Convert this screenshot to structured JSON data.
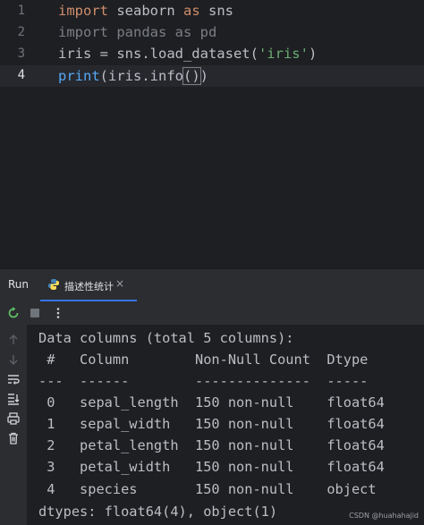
{
  "editor": {
    "line_numbers": [
      "1",
      "2",
      "3",
      "4"
    ],
    "lines": [
      {
        "parts": [
          {
            "text": "import",
            "cls": "kw"
          },
          {
            "text": " seaborn ",
            "cls": ""
          },
          {
            "text": "as",
            "cls": "kw"
          },
          {
            "text": " sns",
            "cls": ""
          }
        ]
      },
      {
        "parts": [
          {
            "text": "import pandas as pd",
            "cls": "dim"
          }
        ]
      },
      {
        "parts": [
          {
            "text": "iris = sns.load_dataset(",
            "cls": ""
          },
          {
            "text": "'iris'",
            "cls": "str"
          },
          {
            "text": ")",
            "cls": ""
          }
        ]
      },
      {
        "parts": [
          {
            "text": "print",
            "cls": "fn"
          },
          {
            "text": "(iris.info",
            "cls": ""
          },
          {
            "text": "()",
            "cls": "paren-box"
          },
          {
            "text": ")",
            "cls": ""
          }
        ]
      }
    ]
  },
  "run_panel": {
    "title": "Run",
    "tab_label": "描述性统计",
    "tab_close": "×"
  },
  "console": {
    "lines": [
      "Data columns (total 5 columns):",
      " #   Column        Non-Null Count  Dtype  ",
      "---  ------        --------------  -----  ",
      " 0   sepal_length  150 non-null    float64",
      " 1   sepal_width   150 non-null    float64",
      " 2   petal_length  150 non-null    float64",
      " 3   petal_width   150 non-null    float64",
      " 4   species       150 non-null    object ",
      "dtypes: float64(4), object(1)"
    ]
  },
  "watermark": "CSDN @huahahajid",
  "icons": {
    "rerun": "rerun-icon",
    "stop": "stop-icon",
    "more": "more-vertical-icon",
    "up": "arrow-up-icon",
    "down": "arrow-down-icon",
    "wrap": "soft-wrap-icon",
    "scroll": "scroll-to-end-icon",
    "print": "print-icon",
    "trash": "trash-icon",
    "python": "python-icon"
  },
  "colors": {
    "background": "#1e1f22",
    "panel": "#2b2d30",
    "keyword": "#cf8e6d",
    "string": "#6aab73",
    "function": "#56a8f5",
    "tab_underline": "#3574f0"
  }
}
